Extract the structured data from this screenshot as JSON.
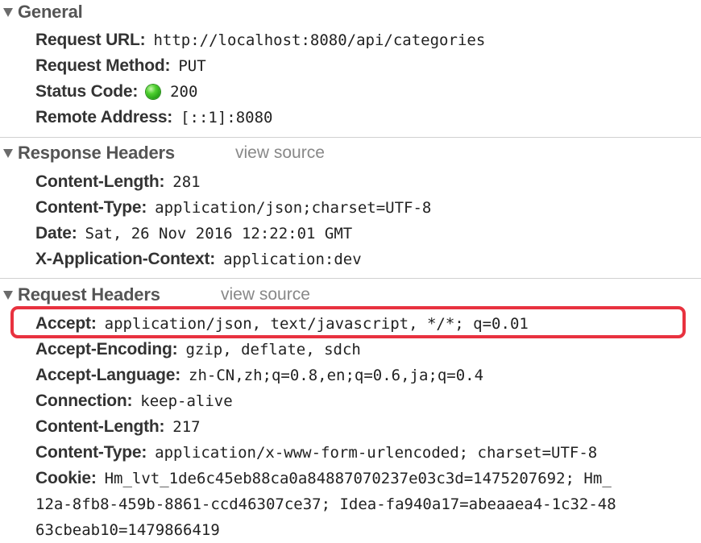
{
  "general": {
    "title": "General",
    "rows": [
      {
        "key": "Request URL:",
        "value": "http://localhost:8080/api/categories"
      },
      {
        "key": "Request Method:",
        "value": "PUT"
      },
      {
        "key": "Status Code:",
        "value": "200"
      },
      {
        "key": "Remote Address:",
        "value": "[::1]:8080"
      }
    ]
  },
  "response_headers": {
    "title": "Response Headers",
    "view_source": "view source",
    "rows": [
      {
        "key": "Content-Length:",
        "value": "281"
      },
      {
        "key": "Content-Type:",
        "value": "application/json;charset=UTF-8"
      },
      {
        "key": "Date:",
        "value": "Sat, 26 Nov 2016 12:22:01 GMT"
      },
      {
        "key": "X-Application-Context:",
        "value": "application:dev"
      }
    ]
  },
  "request_headers": {
    "title": "Request Headers",
    "view_source": "view source",
    "rows": [
      {
        "key": "Accept:",
        "value": "application/json, text/javascript, */*; q=0.01"
      },
      {
        "key": "Accept-Encoding:",
        "value": "gzip, deflate, sdch"
      },
      {
        "key": "Accept-Language:",
        "value": "zh-CN,zh;q=0.8,en;q=0.6,ja;q=0.4"
      },
      {
        "key": "Connection:",
        "value": "keep-alive"
      },
      {
        "key": "Content-Length:",
        "value": "217"
      },
      {
        "key": "Content-Type:",
        "value": "application/x-www-form-urlencoded; charset=UTF-8"
      },
      {
        "key": "Cookie:",
        "value": "Hm_lvt_1de6c45eb88ca0a84887070237e03c3d=1475207692; Hm_"
      }
    ],
    "cookie_continuation": [
      "12a-8fb8-459b-8861-ccd46307ce37; Idea-fa940a17=abeaaea4-1c32-48",
      "63cbeab10=1479866419"
    ]
  },
  "colors": {
    "status_ok": "#2bb51a",
    "highlight": "#e8323f"
  }
}
